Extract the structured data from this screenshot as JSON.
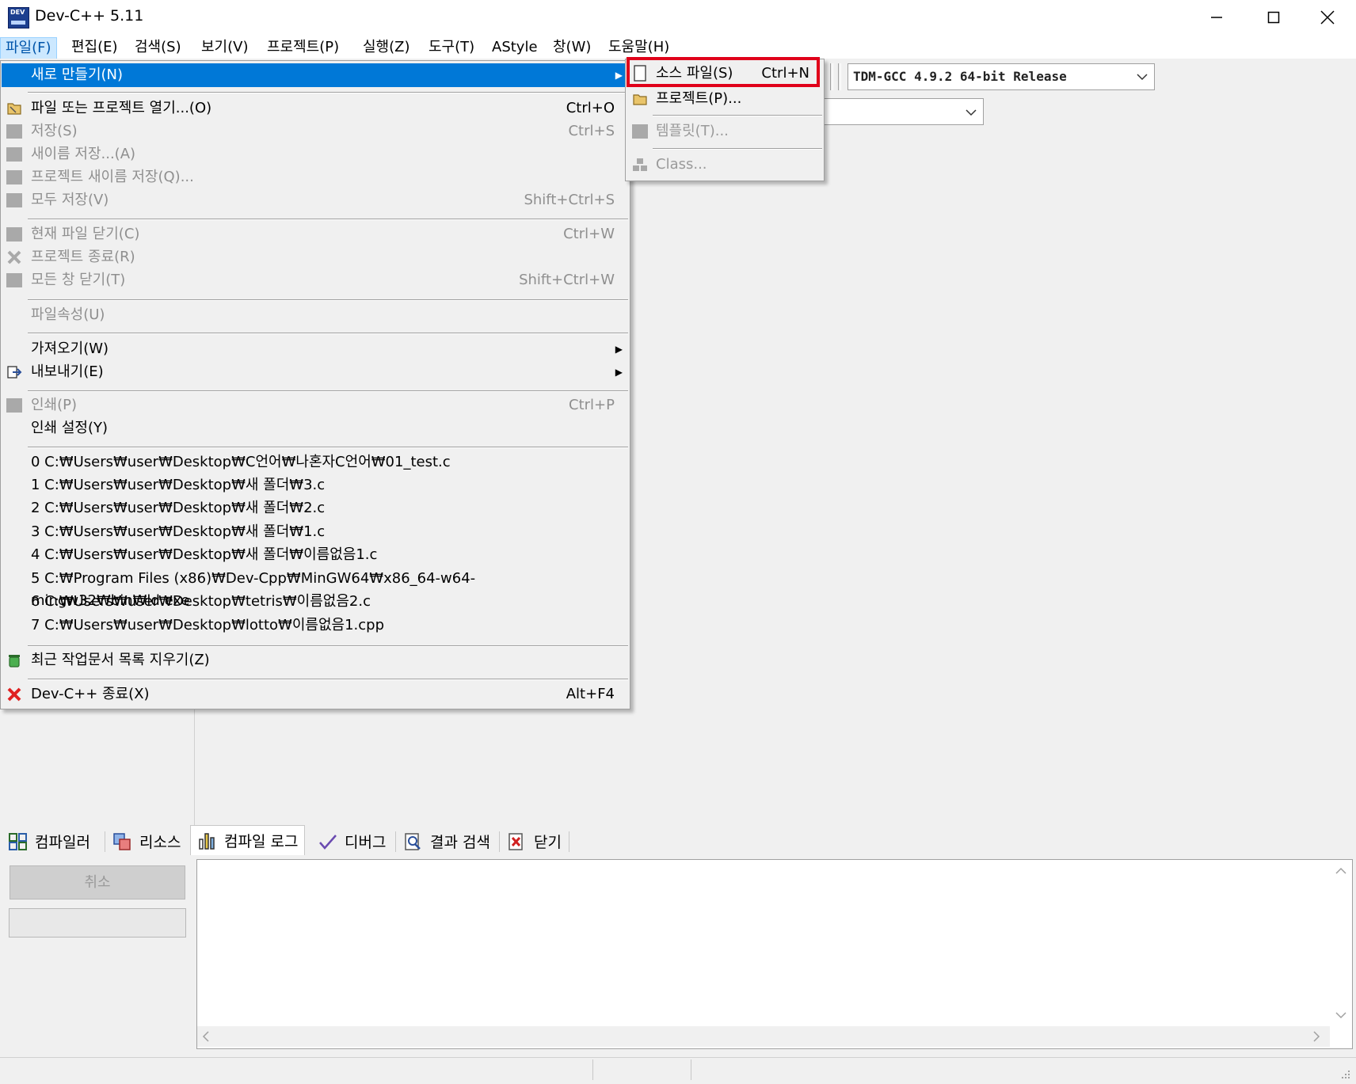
{
  "window": {
    "title": "Dev-C++ 5.11",
    "app_icon_text": "DEV"
  },
  "menubar": [
    {
      "label": "파일(F)",
      "active": true
    },
    {
      "label": "편집(E)"
    },
    {
      "label": "검색(S)"
    },
    {
      "label": "보기(V)"
    },
    {
      "label": "프로젝트(P)"
    },
    {
      "label": "실행(Z)"
    },
    {
      "label": "도구(T)"
    },
    {
      "label": "AStyle"
    },
    {
      "label": "창(W)"
    },
    {
      "label": "도움말(H)"
    }
  ],
  "toolbar": {
    "compiler_selected": "TDM-GCC 4.9.2 64-bit Release"
  },
  "file_menu": {
    "new": {
      "label": "새로 만들기(N)"
    },
    "open": {
      "label": "파일 또는 프로젝트 열기...(O)",
      "shortcut": "Ctrl+O"
    },
    "save": {
      "label": "저장(S)",
      "shortcut": "Ctrl+S"
    },
    "save_as": {
      "label": "새이름 저장...(A)"
    },
    "save_project_as": {
      "label": "프로젝트 새이름 저장(Q)..."
    },
    "save_all": {
      "label": "모두 저장(V)",
      "shortcut": "Shift+Ctrl+S"
    },
    "close_file": {
      "label": "현재 파일 닫기(C)",
      "shortcut": "Ctrl+W"
    },
    "close_project": {
      "label": "프로젝트 종료(R)"
    },
    "close_all": {
      "label": "모든 창 닫기(T)",
      "shortcut": "Shift+Ctrl+W"
    },
    "properties": {
      "label": "파일속성(U)"
    },
    "import": {
      "label": "가져오기(W)"
    },
    "export": {
      "label": "내보내기(E)"
    },
    "print": {
      "label": "인쇄(P)",
      "shortcut": "Ctrl+P"
    },
    "print_setup": {
      "label": "인쇄 설정(Y)"
    },
    "recent": [
      "0 C:₩Users₩user₩Desktop₩C언어₩나혼자C언어₩01_test.c",
      "1 C:₩Users₩user₩Desktop₩새 폴더₩3.c",
      "2 C:₩Users₩user₩Desktop₩새 폴더₩2.c",
      "3 C:₩Users₩user₩Desktop₩새 폴더₩1.c",
      "4 C:₩Users₩user₩Desktop₩새 폴더₩이름없음1.c",
      "5 C:₩Program Files (x86)₩Dev-Cpp₩MinGW64₩x86_64-w64-mingw32₩bin₩ld.exe",
      "6 C:₩Users₩user₩Desktop₩tetris₩이름없음2.c",
      "7 C:₩Users₩user₩Desktop₩lotto₩이름없음1.cpp"
    ],
    "clear_recent": {
      "label": "최근 작업문서 목록 지우기(Z)"
    },
    "exit": {
      "label": "Dev-C++ 종료(X)",
      "shortcut": "Alt+F4"
    }
  },
  "new_submenu": {
    "source_file": {
      "label": "소스 파일(S)",
      "shortcut": "Ctrl+N"
    },
    "project": {
      "label": "프로젝트(P)..."
    },
    "template": {
      "label": "템플릿(T)..."
    },
    "class": {
      "label": "Class..."
    }
  },
  "bottom_tabs": [
    {
      "label": "컴파일러",
      "icon": "grid-icon"
    },
    {
      "label": "리소스",
      "icon": "resources-icon"
    },
    {
      "label": "컴파일 로그",
      "icon": "chart-icon",
      "active": true
    },
    {
      "label": "디버그",
      "icon": "check-icon"
    },
    {
      "label": "결과 검색",
      "icon": "search-doc-icon"
    },
    {
      "label": "닫기",
      "icon": "close-doc-icon"
    }
  ],
  "bottom_panel": {
    "cancel_label": "취소"
  },
  "colors": {
    "menu_highlight": "#0078d7",
    "annotation_red": "#e0001a"
  }
}
